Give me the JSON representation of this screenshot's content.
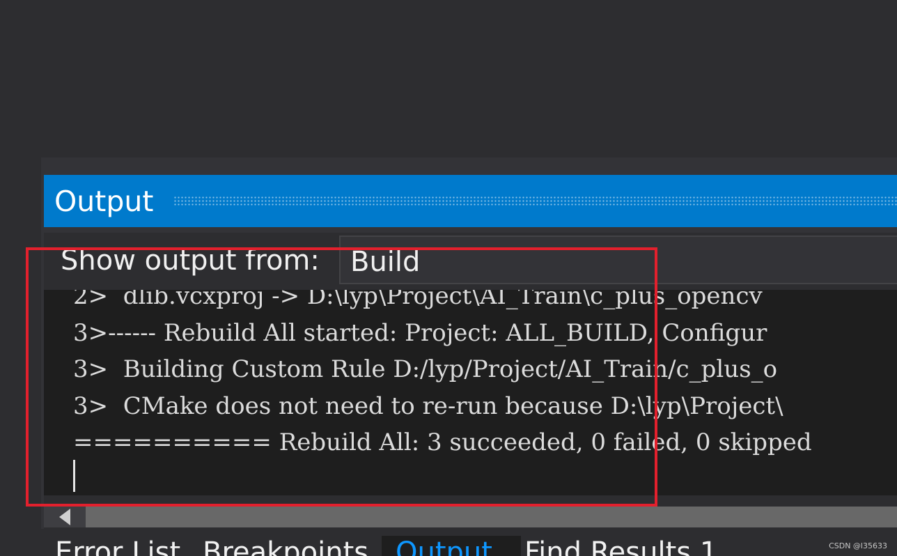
{
  "output": {
    "title": "Output",
    "show_output_label": "Show output from:",
    "source_selected": "Build",
    "lines": [
      "2>  dlib.vcxproj -> D:\\lyp\\Project\\AI_Train\\c_plus_opencv",
      "3>------ Rebuild All started: Project: ALL_BUILD, Configur",
      "3>  Building Custom Rule D:/lyp/Project/AI_Train/c_plus_o",
      "3>  CMake does not need to re-run because D:\\lyp\\Project\\",
      "========== Rebuild All: 3 succeeded, 0 failed, 0 skipped"
    ]
  },
  "tabs": [
    {
      "label": "Error List"
    },
    {
      "label": "Breakpoints"
    },
    {
      "label": "Output"
    },
    {
      "label": "Find Results 1"
    }
  ],
  "colors": {
    "accent": "#007acc",
    "annotation_box": "#e3202d",
    "active_tab_text": "#0e97ff"
  },
  "watermark": "CSDN @l35633"
}
